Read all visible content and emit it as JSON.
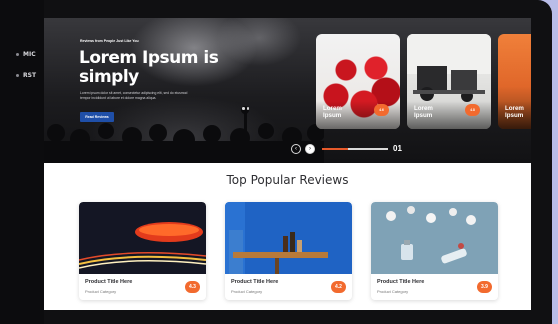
{
  "device": {
    "side_buttons": [
      "MIC",
      "RST"
    ]
  },
  "hero": {
    "kicker": "Reviews from People Just Like You",
    "title": "Lorem Ipsum is simply",
    "description": "Lorem ipsum dolor sit amet, consectetur adipiscing elit, sed do eiusmod tempor incididunt ut labore et dolore magna aliqua.",
    "button_label": "Read Reviews",
    "cards": [
      {
        "label": "Lorem Ipsum",
        "badge": "4.6"
      },
      {
        "label": "Lorem Ipsum",
        "badge": "4.8"
      },
      {
        "label": "Lorem Ipsum",
        "badge": ""
      }
    ],
    "slide_number": "01",
    "progress_fraction": 0.4
  },
  "reviews": {
    "section_title": "Top Popular Reviews",
    "items": [
      {
        "title": "Product Title Here",
        "category": "Product Category",
        "rating": "4.3"
      },
      {
        "title": "Product Title Here",
        "category": "Product Category",
        "rating": "4.2"
      },
      {
        "title": "Product Title Here",
        "category": "Product Category",
        "rating": "3.9"
      }
    ]
  },
  "colors": {
    "accent": "#f26a2e",
    "button_blue": "#1f4fa8",
    "device": "#101012",
    "background": "#b9bde8"
  }
}
